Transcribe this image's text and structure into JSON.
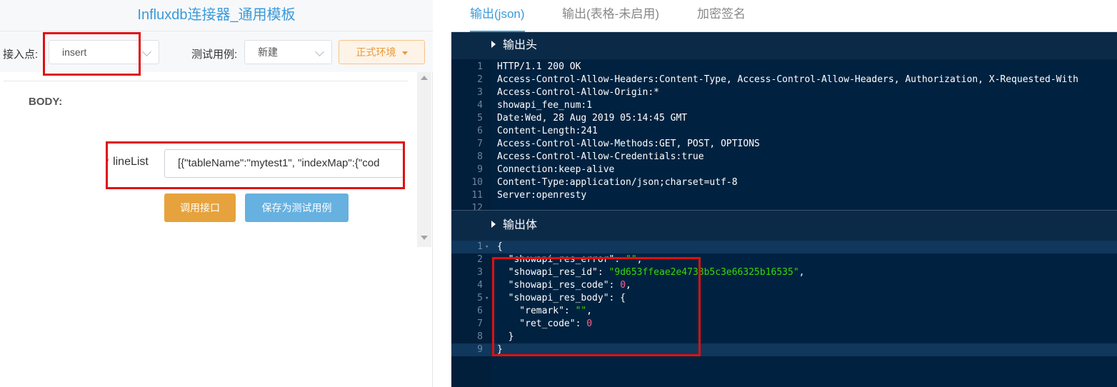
{
  "left": {
    "title": "Influxdb连接器_通用模板",
    "endpoint_label": "接入点:",
    "endpoint_value": "insert",
    "testcase_label": "测试用例:",
    "testcase_value": "新建",
    "env_button": "正式环境",
    "body_label": "BODY:",
    "field_required_mark": "*",
    "field_name": "lineList",
    "field_value": "[{\"tableName\":\"mytest1\", \"indexMap\":{\"cod",
    "call_button": "调用接口",
    "save_button": "保存为测试用例"
  },
  "right": {
    "tabs": [
      {
        "label": "输出(json)",
        "active": true
      },
      {
        "label": "输出(表格-未启用)",
        "active": false
      },
      {
        "label": "加密签名",
        "active": false
      }
    ],
    "headers_section": "输出头",
    "headers": [
      "HTTP/1.1 200 OK",
      "Access-Control-Allow-Headers:Content-Type, Access-Control-Allow-Headers, Authorization, X-Requested-With",
      "Access-Control-Allow-Origin:*",
      "showapi_fee_num:1",
      "Date:Wed, 28 Aug 2019 05:14:45 GMT",
      "Content-Length:241",
      "Access-Control-Allow-Methods:GET, POST, OPTIONS",
      "Access-Control-Allow-Credentials:true",
      "Connection:keep-alive",
      "Content-Type:application/json;charset=utf-8",
      "Server:openresty",
      ""
    ],
    "body_section": "输出体",
    "body_lines": [
      {
        "n": "1",
        "fold": true,
        "parts": [
          {
            "t": "{",
            "c": "k"
          }
        ]
      },
      {
        "n": "2",
        "fold": false,
        "parts": [
          {
            "t": "  \"showapi_res_error\": ",
            "c": "k"
          },
          {
            "t": "\"\"",
            "c": "s"
          },
          {
            "t": ",",
            "c": "k"
          }
        ]
      },
      {
        "n": "3",
        "fold": false,
        "parts": [
          {
            "t": "  \"showapi_res_id\": ",
            "c": "k"
          },
          {
            "t": "\"9d653ffeae2e4738b5c3e66325b16535\"",
            "c": "s"
          },
          {
            "t": ",",
            "c": "k"
          }
        ]
      },
      {
        "n": "4",
        "fold": false,
        "parts": [
          {
            "t": "  \"showapi_res_code\": ",
            "c": "k"
          },
          {
            "t": "0",
            "c": "n"
          },
          {
            "t": ",",
            "c": "k"
          }
        ]
      },
      {
        "n": "5",
        "fold": true,
        "parts": [
          {
            "t": "  \"showapi_res_body\": {",
            "c": "k"
          }
        ]
      },
      {
        "n": "6",
        "fold": false,
        "parts": [
          {
            "t": "    \"remark\": ",
            "c": "k"
          },
          {
            "t": "\"\"",
            "c": "s"
          },
          {
            "t": ",",
            "c": "k"
          }
        ]
      },
      {
        "n": "7",
        "fold": false,
        "parts": [
          {
            "t": "    \"ret_code\": ",
            "c": "k"
          },
          {
            "t": "0",
            "c": "n"
          }
        ]
      },
      {
        "n": "8",
        "fold": false,
        "parts": [
          {
            "t": "  }",
            "c": "k"
          }
        ]
      },
      {
        "n": "9",
        "fold": false,
        "parts": [
          {
            "t": "}",
            "c": "k"
          }
        ]
      }
    ]
  },
  "colors": {
    "accent": "#3a9ad9",
    "editor_bg": "#002240",
    "string": "#3ad900",
    "number": "#ff628c",
    "highlight_box": "#e01010"
  }
}
